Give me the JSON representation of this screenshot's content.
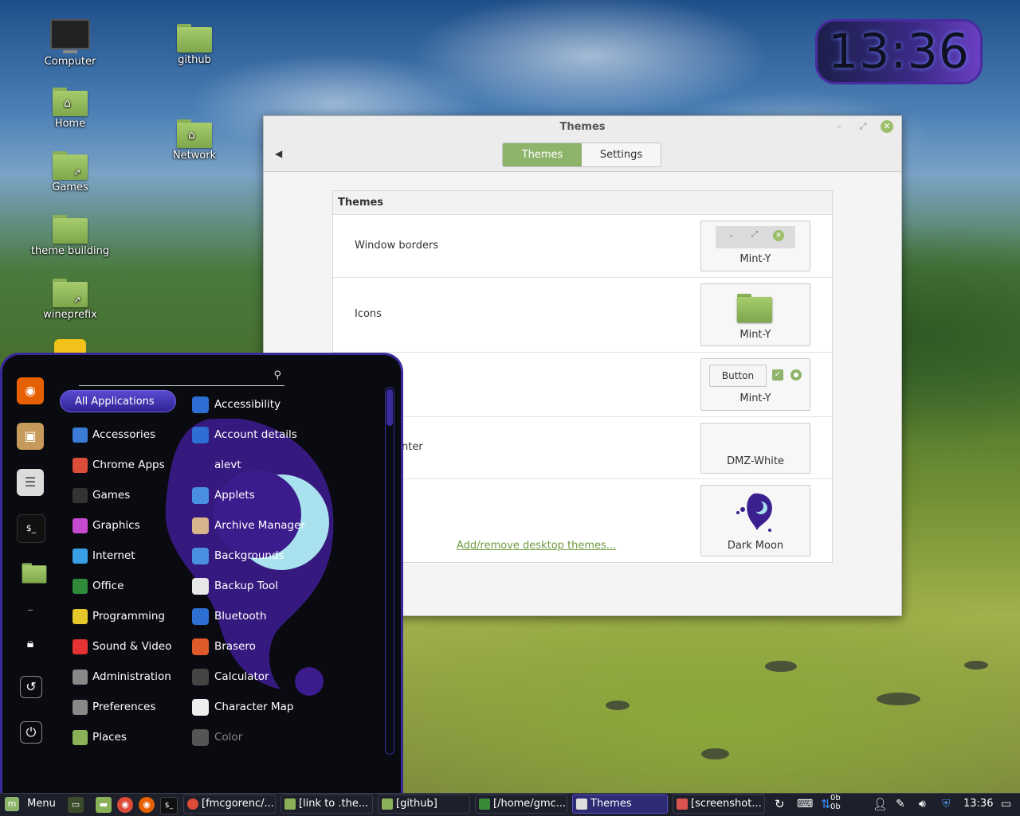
{
  "desktop": {
    "icons": [
      {
        "label": "Computer"
      },
      {
        "label": "Home"
      },
      {
        "label": "Games"
      },
      {
        "label": "theme building"
      },
      {
        "label": "wineprefix"
      },
      {
        "label": "github"
      },
      {
        "label": "Network"
      }
    ],
    "clock": "13:36"
  },
  "themes_window": {
    "title": "Themes",
    "tabs": [
      "Themes",
      "Settings"
    ],
    "active_tab": "Themes",
    "panel_title": "Themes",
    "rows": [
      {
        "label": "Window borders",
        "value": "Mint-Y"
      },
      {
        "label": "Icons",
        "value": "Mint-Y"
      },
      {
        "label": "",
        "value": "Mint-Y",
        "sample_button": "Button"
      },
      {
        "label": "nter",
        "value": "DMZ-White"
      },
      {
        "label": "",
        "value": "Dark Moon"
      }
    ],
    "add_link": "Add/remove desktop themes..."
  },
  "menu": {
    "search_value": "",
    "favorites": [
      "firefox",
      "package",
      "settings",
      "terminal",
      "files",
      "separator",
      "lock",
      "logout",
      "shutdown"
    ],
    "categories": [
      {
        "label": "All Applications"
      },
      {
        "label": "Accessories",
        "icon": "scissors-icon",
        "color": "#3b7bd6"
      },
      {
        "label": "Chrome Apps",
        "icon": "chrome-icon",
        "color": "#dd4b39"
      },
      {
        "label": "Games",
        "icon": "gamepad-icon",
        "color": "#333333"
      },
      {
        "label": "Graphics",
        "icon": "palette-icon",
        "color": "#c54ad1"
      },
      {
        "label": "Internet",
        "icon": "cloud-icon",
        "color": "#3aa0e6"
      },
      {
        "label": "Office",
        "icon": "office-icon",
        "color": "#2f8a3a"
      },
      {
        "label": "Programming",
        "icon": "code-icon",
        "color": "#e6c82b"
      },
      {
        "label": "Sound & Video",
        "icon": "play-icon",
        "color": "#e53333"
      },
      {
        "label": "Administration",
        "icon": "admin-icon",
        "color": "#888888"
      },
      {
        "label": "Preferences",
        "icon": "preferences-icon",
        "color": "#888888"
      },
      {
        "label": "Places",
        "icon": "folder-icon",
        "color": "#8bb158"
      }
    ],
    "apps": [
      {
        "label": "Accessibility",
        "icon": "accessibility-icon",
        "color": "#2d6fd3"
      },
      {
        "label": "Account details",
        "icon": "account-icon",
        "color": "#2d6fd3"
      },
      {
        "label": "alevt",
        "icon": "",
        "color": ""
      },
      {
        "label": "Applets",
        "icon": "applets-icon",
        "color": "#4a90e2"
      },
      {
        "label": "Archive Manager",
        "icon": "archive-icon",
        "color": "#d9b38c"
      },
      {
        "label": "Backgrounds",
        "icon": "backgrounds-icon",
        "color": "#4a90e2"
      },
      {
        "label": "Backup Tool",
        "icon": "backup-icon",
        "color": "#e8e8e8"
      },
      {
        "label": "Bluetooth",
        "icon": "bluetooth-icon",
        "color": "#2d6fd3"
      },
      {
        "label": "Brasero",
        "icon": "brasero-icon",
        "color": "#e05a2b"
      },
      {
        "label": "Calculator",
        "icon": "calculator-icon",
        "color": "#444444"
      },
      {
        "label": "Character Map",
        "icon": "charmap-icon",
        "color": "#eeeeee"
      },
      {
        "label": "Color",
        "icon": "color-icon",
        "color": "#555555"
      }
    ]
  },
  "taskbar": {
    "menu_label": "Menu",
    "tasks": [
      {
        "label": "[fmcgorenc/...",
        "icon": "chrome-icon"
      },
      {
        "label": "[link to .the...",
        "icon": "folder-icon"
      },
      {
        "label": "[github]",
        "icon": "folder-icon"
      },
      {
        "label": "[/home/gmc...",
        "icon": "terminal-icon"
      },
      {
        "label": "Themes",
        "icon": "themes-icon",
        "active": true
      },
      {
        "label": "[screenshot...",
        "icon": "image-icon"
      }
    ],
    "net_up": "0b",
    "net_down": "0b",
    "time": "13:36"
  }
}
